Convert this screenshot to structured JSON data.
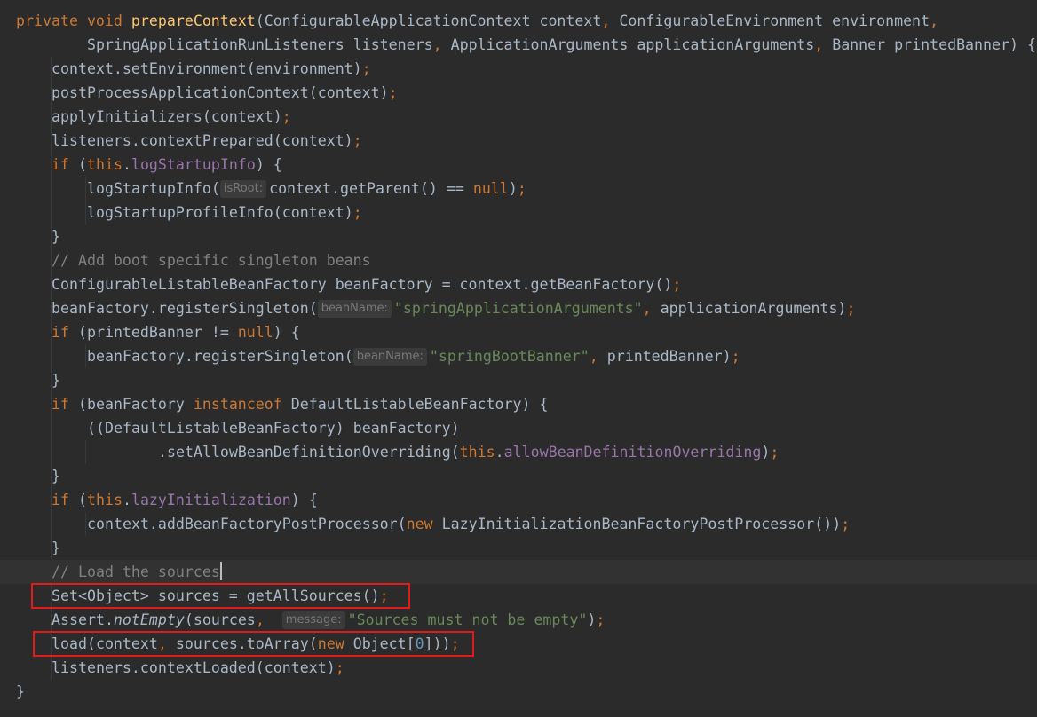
{
  "editor": {
    "lines": [
      [
        {
          "t": "private ",
          "c": "kw"
        },
        {
          "t": "void ",
          "c": "kw"
        },
        {
          "t": "prepareContext",
          "c": "fn"
        },
        {
          "t": "(ConfigurableApplicationContext context"
        },
        {
          "t": ", ",
          "c": "kw"
        },
        {
          "t": "ConfigurableEnvironment environment"
        },
        {
          "t": ",",
          "c": "kw"
        }
      ],
      [
        {
          "t": "SpringApplicationRunListeners listeners"
        },
        {
          "t": ", ",
          "c": "kw"
        },
        {
          "t": "ApplicationArguments applicationArguments"
        },
        {
          "t": ", ",
          "c": "kw"
        },
        {
          "t": "Banner printedBanner) {"
        }
      ],
      [
        {
          "t": "context.setEnvironment(environment)"
        },
        {
          "t": ";",
          "c": "kw"
        }
      ],
      [
        {
          "t": "postProcessApplicationContext(context)"
        },
        {
          "t": ";",
          "c": "kw"
        }
      ],
      [
        {
          "t": "applyInitializers(context)"
        },
        {
          "t": ";",
          "c": "kw"
        }
      ],
      [
        {
          "t": "listeners.contextPrepared(context)"
        },
        {
          "t": ";",
          "c": "kw"
        }
      ],
      [
        {
          "t": "if ",
          "c": "kw"
        },
        {
          "t": "("
        },
        {
          "t": "this",
          "c": "kw"
        },
        {
          "t": "."
        },
        {
          "t": "logStartupInfo",
          "c": "field"
        },
        {
          "t": ") {"
        }
      ],
      [
        {
          "t": "logStartupInfo("
        },
        {
          "hint": "isRoot:"
        },
        {
          "t": "context.getParent() == "
        },
        {
          "t": "null",
          "c": "kw"
        },
        {
          "t": ")"
        },
        {
          "t": ";",
          "c": "kw"
        }
      ],
      [
        {
          "t": "logStartupProfileInfo(context)"
        },
        {
          "t": ";",
          "c": "kw"
        }
      ],
      [
        {
          "t": "}"
        }
      ],
      [
        {
          "t": "// Add boot specific singleton beans",
          "c": "cm"
        }
      ],
      [
        {
          "t": "ConfigurableListableBeanFactory beanFactory = context.getBeanFactory()"
        },
        {
          "t": ";",
          "c": "kw"
        }
      ],
      [
        {
          "t": "beanFactory.registerSingleton("
        },
        {
          "hint": "beanName:"
        },
        {
          "t": "\"springApplicationArguments\"",
          "c": "str"
        },
        {
          "t": ", ",
          "c": "kw"
        },
        {
          "t": "applicationArguments)"
        },
        {
          "t": ";",
          "c": "kw"
        }
      ],
      [
        {
          "t": "if ",
          "c": "kw"
        },
        {
          "t": "(printedBanner != "
        },
        {
          "t": "null",
          "c": "kw"
        },
        {
          "t": ") {"
        }
      ],
      [
        {
          "t": "beanFactory.registerSingleton("
        },
        {
          "hint": "beanName:"
        },
        {
          "t": "\"springBootBanner\"",
          "c": "str"
        },
        {
          "t": ", ",
          "c": "kw"
        },
        {
          "t": "printedBanner)"
        },
        {
          "t": ";",
          "c": "kw"
        }
      ],
      [
        {
          "t": "}"
        }
      ],
      [
        {
          "t": "if ",
          "c": "kw"
        },
        {
          "t": "(beanFactory "
        },
        {
          "t": "instanceof ",
          "c": "kw"
        },
        {
          "t": "DefaultListableBeanFactory) {"
        }
      ],
      [
        {
          "t": "((DefaultListableBeanFactory) beanFactory)"
        }
      ],
      [
        {
          "t": ".setAllowBeanDefinitionOverriding("
        },
        {
          "t": "this",
          "c": "kw"
        },
        {
          "t": "."
        },
        {
          "t": "allowBeanDefinitionOverriding",
          "c": "field"
        },
        {
          "t": ")"
        },
        {
          "t": ";",
          "c": "kw"
        }
      ],
      [
        {
          "t": "}"
        }
      ],
      [
        {
          "t": "if ",
          "c": "kw"
        },
        {
          "t": "("
        },
        {
          "t": "this",
          "c": "kw"
        },
        {
          "t": "."
        },
        {
          "t": "lazyInitialization",
          "c": "field"
        },
        {
          "t": ") {"
        }
      ],
      [
        {
          "t": "context.addBeanFactoryPostProcessor("
        },
        {
          "t": "new ",
          "c": "kw"
        },
        {
          "t": "LazyInitializationBeanFactoryPostProcessor())"
        },
        {
          "t": ";",
          "c": "kw"
        }
      ],
      [
        {
          "t": "}"
        }
      ],
      [
        {
          "t": "// Load the sources",
          "c": "cm"
        },
        {
          "caret": true
        }
      ],
      [
        {
          "t": "Set<Object> sources = getAllSources()"
        },
        {
          "t": ";",
          "c": "kw"
        }
      ],
      [
        {
          "t": "Assert."
        },
        {
          "t": "notEmpty",
          "c": "static-call"
        },
        {
          "t": "(sources"
        },
        {
          "t": ",  ",
          "c": "kw"
        },
        {
          "hint": "message:"
        },
        {
          "t": "\"Sources must not be empty\"",
          "c": "str"
        },
        {
          "t": ")"
        },
        {
          "t": ";",
          "c": "kw"
        }
      ],
      [
        {
          "t": "load(context"
        },
        {
          "t": ", ",
          "c": "kw"
        },
        {
          "t": "sources.toArray("
        },
        {
          "t": "new ",
          "c": "kw"
        },
        {
          "t": "Object["
        },
        {
          "t": "0",
          "c": "num"
        },
        {
          "t": "]))"
        },
        {
          "t": ";",
          "c": "kw"
        }
      ],
      [
        {
          "t": "listeners.contextLoaded(context)"
        },
        {
          "t": ";",
          "c": "kw"
        }
      ],
      [
        {
          "t": "}"
        }
      ]
    ],
    "highlighted_lines": [
      24,
      26
    ]
  }
}
